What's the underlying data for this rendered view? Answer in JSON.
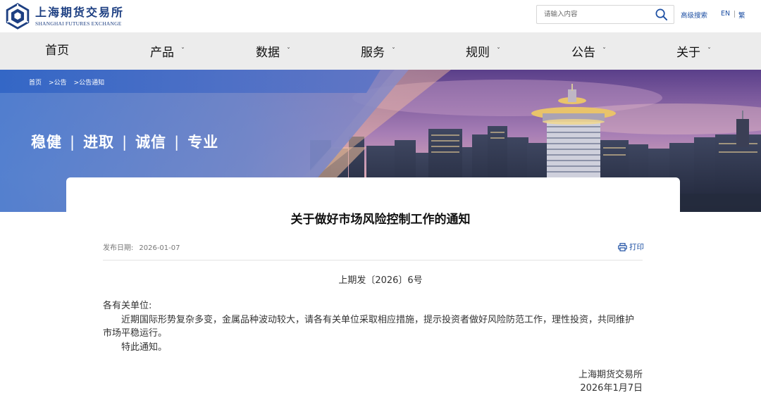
{
  "header": {
    "logo_cn": "上海期货交易所",
    "logo_en": "SHANGHAI FUTURES EXCHANGE",
    "search_placeholder": "请输入内容",
    "advanced_search": "高级搜索",
    "lang_en": "EN",
    "lang_tw": "繁"
  },
  "nav": {
    "items": [
      {
        "label": "首页",
        "has_dropdown": false
      },
      {
        "label": "产品",
        "has_dropdown": true
      },
      {
        "label": "数据",
        "has_dropdown": true
      },
      {
        "label": "服务",
        "has_dropdown": true
      },
      {
        "label": "规则",
        "has_dropdown": true
      },
      {
        "label": "公告",
        "has_dropdown": true
      },
      {
        "label": "关于",
        "has_dropdown": true
      }
    ]
  },
  "breadcrumb": [
    "首页",
    "公告",
    "公告通知"
  ],
  "breadcrumb_sep": ">",
  "slogan": [
    "稳健",
    "进取",
    "诚信",
    "专业"
  ],
  "slogan_sep": "|",
  "article": {
    "title": "关于做好市场风险控制工作的通知",
    "date_label": "发布日期:",
    "date": "2026-01-07",
    "print_label": "打印",
    "doc_no": "上期发〔2026〕6号",
    "salutation": "各有关单位:",
    "para1": "近期国际形势复杂多变，金属品种波动较大，请各有关单位采取相应措施，提示投资者做好风险防范工作，理性投资，共同维护市场平稳运行。",
    "para2": "特此通知。",
    "signature_org": "上海期货交易所",
    "signature_date": "2026年1月7日"
  },
  "colors": {
    "brand_blue": "#1d3f82",
    "link_blue": "#1d4fa3",
    "nav_bg": "#ececec"
  }
}
